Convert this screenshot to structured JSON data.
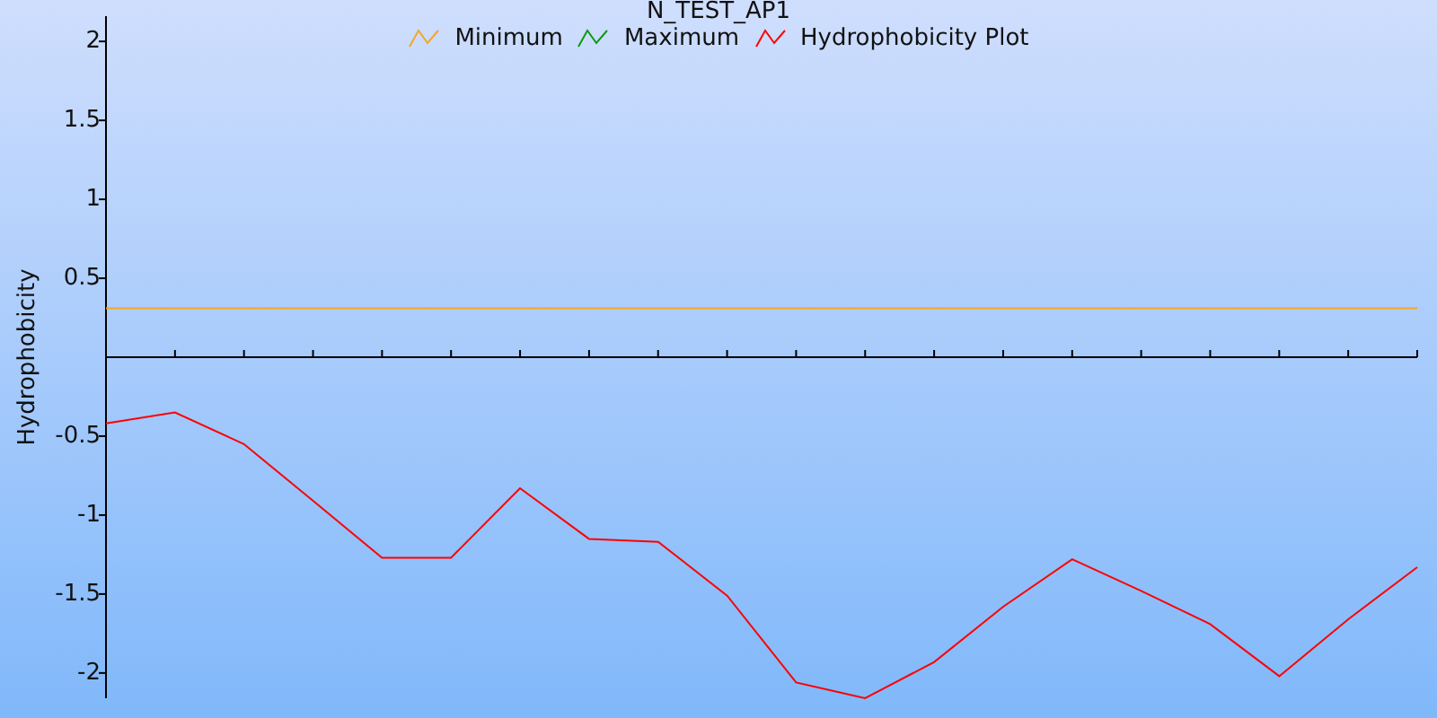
{
  "chart_data": {
    "type": "line",
    "title": "N_TEST_AP1",
    "ylabel": "Hydrophobicity",
    "legend": "top",
    "categories": [
      null,
      null,
      null,
      null,
      null,
      null,
      null,
      null,
      null,
      null,
      null,
      null,
      null,
      null,
      null,
      null,
      null,
      null,
      null,
      null
    ],
    "ylim": [
      -2.16,
      2.16
    ],
    "yticks": [
      -2,
      -1.5,
      -1,
      -0.5,
      0.5,
      1,
      1.5,
      2
    ],
    "series": [
      {
        "name": "Minimum",
        "color": "#f5a623",
        "values": [
          0.31,
          0.31,
          0.31,
          0.31,
          0.31,
          0.31,
          0.31,
          0.31,
          0.31,
          0.31,
          0.31,
          0.31,
          0.31,
          0.31,
          0.31,
          0.31,
          0.31,
          0.31,
          0.31,
          0.31
        ]
      },
      {
        "name": "Maximum",
        "color": "#0a9a0a",
        "values": [
          null,
          null,
          null,
          null,
          null,
          null,
          null,
          null,
          null,
          null,
          null,
          null,
          null,
          null,
          null,
          null,
          null,
          null,
          null,
          null
        ]
      },
      {
        "name": "Hydrophobicity Plot",
        "color": "#ff0000",
        "values": [
          -0.42,
          -0.35,
          -0.55,
          -0.91,
          -1.27,
          -1.27,
          -0.83,
          -1.15,
          -1.17,
          -1.51,
          -2.06,
          -2.16,
          -1.93,
          -1.58,
          -1.28,
          -1.48,
          -1.69,
          -2.02,
          -1.66,
          -1.33
        ]
      }
    ]
  }
}
